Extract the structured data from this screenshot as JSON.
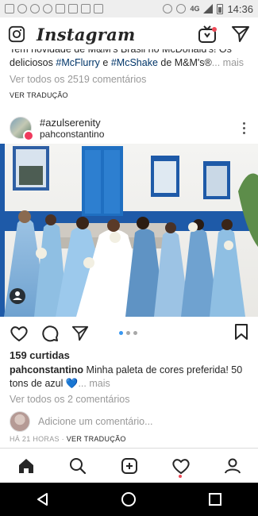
{
  "status_bar": {
    "time": "14:36",
    "network": "4G"
  },
  "app": {
    "title": "Instagram"
  },
  "prev_post": {
    "cut_line": "Tem novidade de M&M's Brasil no McDonald's! Os",
    "caption_part1": "deliciosos ",
    "hashtag1": "#McFlurry",
    "caption_part2": " e ",
    "hashtag2": "#McShake",
    "caption_part3": " de M&M's®",
    "more": "... mais",
    "view_comments": "Ver todos os 2519 comentários",
    "see_translation": "VER TRADUÇÃO"
  },
  "post": {
    "location": "#azulserenity",
    "username": "pahconstantino",
    "likes": "159 curtidas",
    "caption_user": "pahconstantino",
    "caption_text": " Minha paleta de cores preferida! 50 tons de azul 💙",
    "caption_more": "... mais",
    "view_comments": "Ver todos os 2 comentários",
    "add_comment_placeholder": "Adicione um comentário...",
    "time_ago": "HÁ 21 HORAS",
    "separator": " · ",
    "see_translation": "VER TRADUÇÃO"
  },
  "colors": {
    "link": "#003569",
    "muted": "#999999",
    "carousel_active": "#3897f0",
    "badge": "#ef3a5d"
  }
}
